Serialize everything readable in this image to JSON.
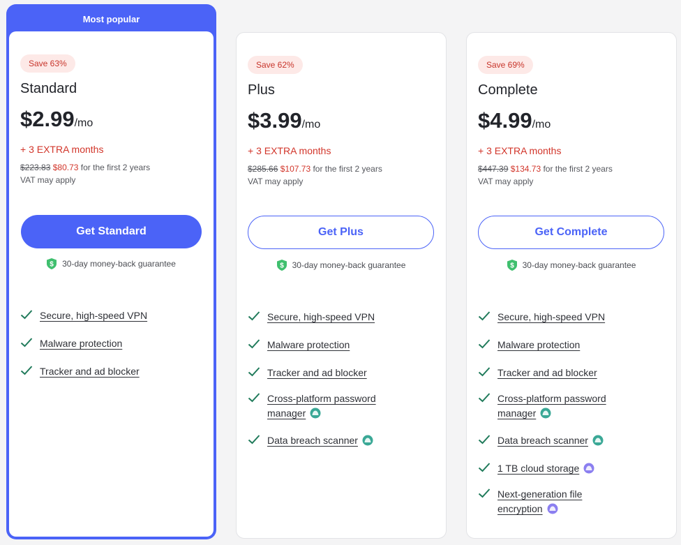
{
  "popular_label": "Most popular",
  "plans": [
    {
      "badge": "Save 63%",
      "name": "Standard",
      "price": "$2.99",
      "per": "/mo",
      "extra": "+ 3 EXTRA months",
      "old_price": "$223.83",
      "new_price": "$80.73",
      "period": " for the first 2 years",
      "vat": "VAT may apply",
      "cta": "Get Standard",
      "guarantee": "30-day money-back guarantee",
      "features": [
        "Secure, high-speed VPN",
        "Malware protection",
        "Tracker and ad blocker"
      ]
    },
    {
      "badge": "Save 62%",
      "name": "Plus",
      "price": "$3.99",
      "per": "/mo",
      "extra": "+ 3 EXTRA months",
      "old_price": "$285.66",
      "new_price": "$107.73",
      "period": " for the first 2 years",
      "vat": "VAT may apply",
      "cta": "Get Plus",
      "guarantee": "30-day money-back guarantee",
      "features": [
        "Secure, high-speed VPN",
        "Malware protection",
        "Tracker and ad blocker",
        "Cross-platform password manager",
        "Data breach scanner"
      ]
    },
    {
      "badge": "Save 69%",
      "name": "Complete",
      "price": "$4.99",
      "per": "/mo",
      "extra": "+ 3 EXTRA months",
      "old_price": "$447.39",
      "new_price": "$134.73",
      "period": " for the first 2 years",
      "vat": "VAT may apply",
      "cta": "Get Complete",
      "guarantee": "30-day money-back guarantee",
      "features": [
        "Secure, high-speed VPN",
        "Malware protection",
        "Tracker and ad blocker",
        "Cross-platform password manager",
        "Data breach scanner",
        "1 TB cloud storage",
        "Next-generation file encryption"
      ]
    }
  ],
  "colors": {
    "accent": "#4b63f7",
    "sale_red": "#d2352a",
    "check_green": "#1f7a5a",
    "shield_green": "#3fbf6e",
    "teal_icon": "#3aa896",
    "purple_icon": "#8b7ff0"
  },
  "icons": {
    "check": "checkmark-icon",
    "shield": "shield-dollar-icon",
    "teal_feature": "password-manager-addon-icon",
    "purple_feature": "cloud-addon-icon"
  }
}
